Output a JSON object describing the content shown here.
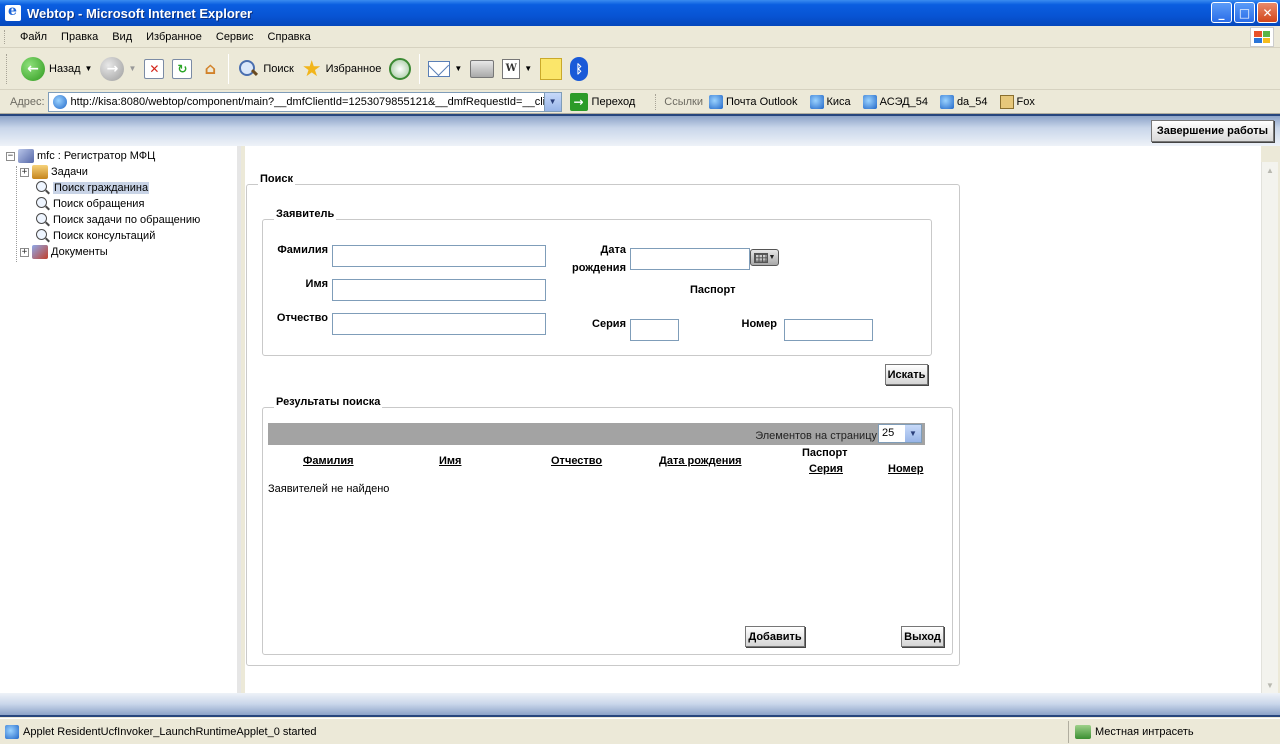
{
  "window": {
    "title": "Webtop - Microsoft Internet Explorer",
    "min": "_",
    "max": "□",
    "close": "✕"
  },
  "menu": [
    "Файл",
    "Правка",
    "Вид",
    "Избранное",
    "Сервис",
    "Справка"
  ],
  "toolbar": {
    "back": "Назад",
    "search": "Поиск",
    "favorites": "Избранное"
  },
  "address": {
    "label": "Адрес:",
    "url": "http://kisa:8080/webtop/component/main?__dmfClientId=1253079855121&__dmfRequestId=__cli",
    "go": "Переход",
    "links_label": "Ссылки",
    "links": [
      "Почта Outlook",
      "Киса",
      "АСЭД_54",
      "da_54",
      "Fox"
    ]
  },
  "webtop": {
    "logout": "Завершение работы"
  },
  "tree": {
    "root": "mfc : Регистратор МФЦ",
    "items": [
      "Задачи",
      "Поиск гражданина",
      "Поиск обращения",
      "Поиск задачи по обращению",
      "Поиск консультаций",
      "Документы"
    ],
    "selected_index": 1
  },
  "search_form": {
    "legend": "Поиск",
    "applicant_legend": "Заявитель",
    "surname_label": "Фамилия",
    "name_label": "Имя",
    "patronymic_label": "Отчество",
    "birth_label_1": "Дата",
    "birth_label_2": "рождения",
    "passport_label": "Паспорт",
    "series_label": "Серия",
    "number_label": "Номер",
    "surname": "",
    "name": "",
    "patronymic": "",
    "birth_date": "",
    "series": "",
    "number": "",
    "search_button": "Искать"
  },
  "results": {
    "legend": "Результаты поиска",
    "per_page_label": "Элементов на страницу",
    "per_page_value": "25",
    "columns": [
      "Фамилия",
      "Имя",
      "Отчество",
      "Дата рождения"
    ],
    "passport_group": "Паспорт",
    "passport_columns": [
      "Серия",
      "Номер"
    ],
    "empty": "Заявителей не найдено",
    "add_button": "Добавить",
    "exit_button": "Выход"
  },
  "status": {
    "text": "Applet ResidentUcfInvoker_LaunchRuntimeApplet_0 started",
    "zone": "Местная интрасеть"
  }
}
